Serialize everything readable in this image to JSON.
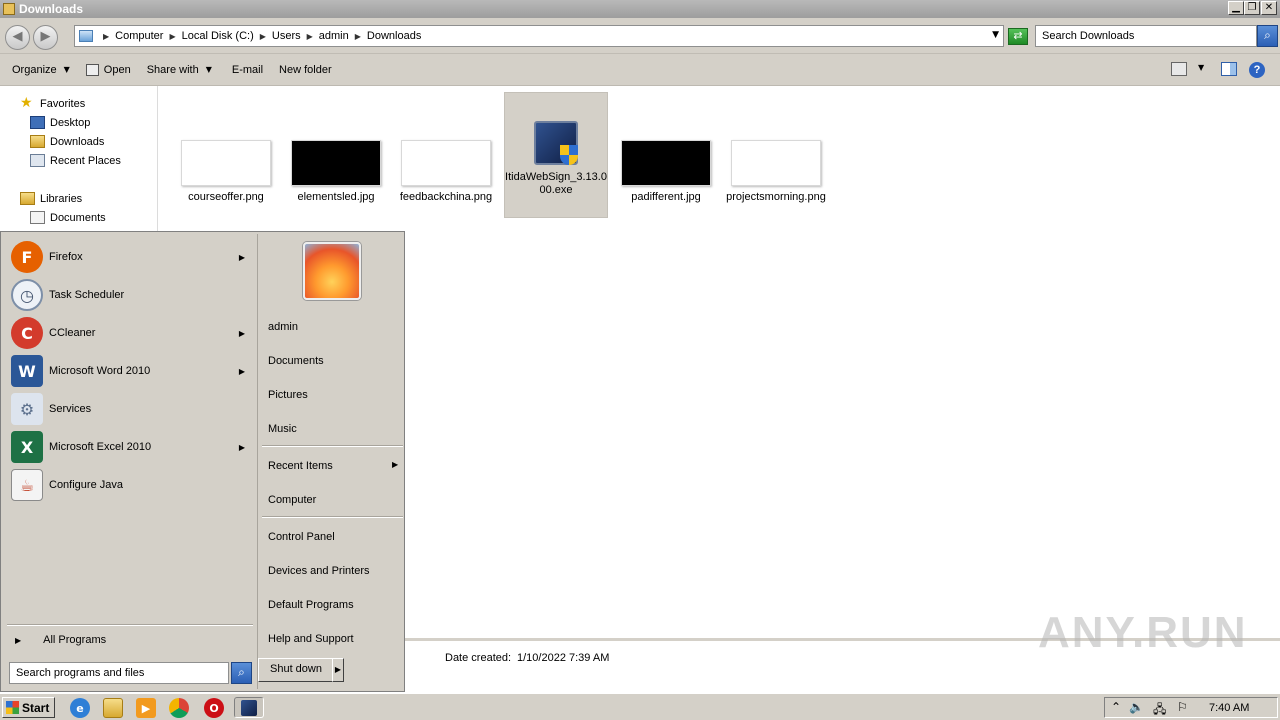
{
  "window": {
    "title": "Downloads"
  },
  "address": {
    "crumbs": [
      "Computer",
      "Local Disk (C:)",
      "Users",
      "admin",
      "Downloads"
    ]
  },
  "search": {
    "placeholder": "Search Downloads"
  },
  "toolbar": {
    "organize": "Organize",
    "open": "Open",
    "share_with": "Share with",
    "email": "E-mail",
    "new_folder": "New folder"
  },
  "nav": {
    "favorites": "Favorites",
    "desktop": "Desktop",
    "downloads": "Downloads",
    "recent_places": "Recent Places",
    "libraries": "Libraries",
    "documents": "Documents"
  },
  "files": [
    {
      "name": "courseoffer.png",
      "thumb_color": "#ffffff"
    },
    {
      "name": "elementsled.jpg",
      "thumb_color": "#000000"
    },
    {
      "name": "feedbackchina.png",
      "thumb_color": "#ffffff"
    },
    {
      "name": "ItidaWebSign_3.13.000.exe",
      "thumb_color": "#1f3c78"
    },
    {
      "name": "padifferent.jpg",
      "thumb_color": "#000000"
    },
    {
      "name": "projectsmorning.png",
      "thumb_color": "#ffffff"
    }
  ],
  "details": {
    "label": "Date created:",
    "value": "1/10/2022 7:39 AM"
  },
  "watermark": "ANY.RUN",
  "start_menu": {
    "programs": [
      {
        "label": "Firefox",
        "icon": "firefox-icon",
        "color": "#e66000",
        "glyph": "F",
        "arrow": true
      },
      {
        "label": "Task Scheduler",
        "icon": "clock-icon",
        "color": "#7d8fa8",
        "glyph": "◷",
        "arrow": false
      },
      {
        "label": "CCleaner",
        "icon": "ccleaner-icon",
        "color": "#d33b2c",
        "glyph": "C",
        "arrow": true
      },
      {
        "label": "Microsoft Word 2010",
        "icon": "word-icon",
        "color": "#2b5797",
        "glyph": "W",
        "arrow": true
      },
      {
        "label": "Services",
        "icon": "gears-icon",
        "color": "#8a9bb0",
        "glyph": "⚙",
        "arrow": false
      },
      {
        "label": "Microsoft Excel 2010",
        "icon": "excel-icon",
        "color": "#1e7145",
        "glyph": "X",
        "arrow": true
      },
      {
        "label": "Configure Java",
        "icon": "java-icon",
        "color": "#5382a1",
        "glyph": "☕",
        "arrow": false
      }
    ],
    "all_programs": "All Programs",
    "search_placeholder": "Search programs and files",
    "places": {
      "admin": "admin",
      "documents": "Documents",
      "pictures": "Pictures",
      "music": "Music",
      "recent_items": "Recent Items",
      "computer": "Computer",
      "control_panel": "Control Panel",
      "devices_printers": "Devices and Printers",
      "default_programs": "Default Programs",
      "help_support": "Help and Support"
    },
    "shutdown": "Shut down"
  },
  "taskbar": {
    "start": "Start",
    "clock": "7:40 AM"
  }
}
